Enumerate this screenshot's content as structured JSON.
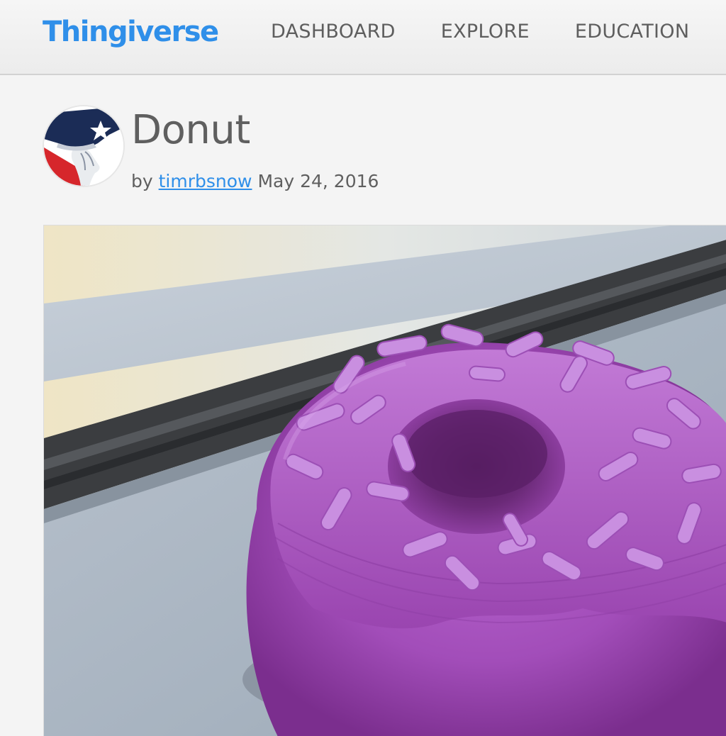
{
  "header": {
    "logo_text": "Thingiverse",
    "nav_items": [
      {
        "label": "DASHBOARD"
      },
      {
        "label": "EXPLORE"
      },
      {
        "label": "EDUCATION"
      }
    ]
  },
  "thing": {
    "title": "Donut",
    "by_prefix": "by",
    "author": "timrbsnow",
    "date": "May 24, 2016",
    "image_subject": "purple 3D-printed donut with sprinkles"
  },
  "colors": {
    "brand_blue": "#2f8fe9",
    "text_gray": "#5f5f5f",
    "donut_purple": "#a64fc0"
  }
}
